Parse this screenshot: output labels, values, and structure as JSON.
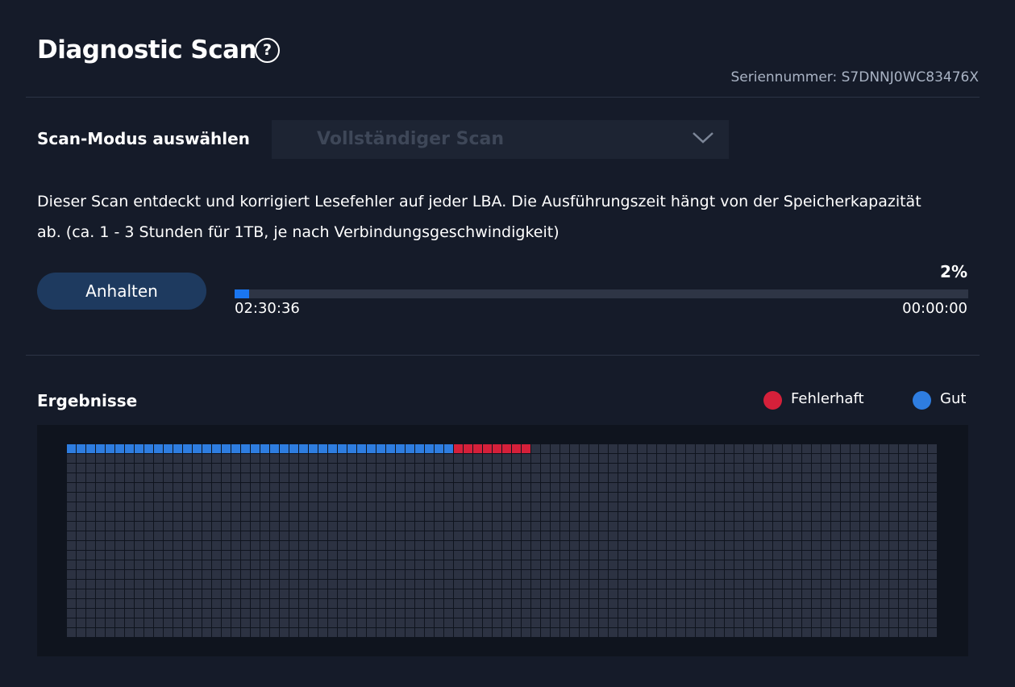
{
  "header": {
    "title": "Diagnostic Scan",
    "help_icon": "question-circle-icon",
    "help_glyph": "?",
    "serial": "Seriennummer: S7DNNJ0WC83476X"
  },
  "scan_mode": {
    "label": "Scan-Modus auswählen",
    "selected": "Vollständiger Scan",
    "dropdown_icon": "chevron-down-icon"
  },
  "description": "Dieser Scan entdeckt und korrigiert Lesefehler auf jeder LBA. Die Ausführungszeit hängt von der Speicherkapazität ab. (ca. 1 - 3 Stunden für 1TB, je nach Verbindungsgeschwindigkeit)",
  "progress": {
    "button_label": "Anhalten",
    "percent_label": "2%",
    "value": 0.02,
    "elapsed": "02:30:36",
    "remaining": "00:00:00"
  },
  "results": {
    "label": "Ergebnisse",
    "legend": [
      {
        "label": "Fehlerhaft",
        "color": "#d5203a"
      },
      {
        "label": "Gut",
        "color": "#2e7de0"
      }
    ],
    "grid": {
      "columns": 90,
      "rows": 20,
      "good_blocks": 40,
      "bad_blocks": 8
    },
    "colors": {
      "good": "#2e7de0",
      "bad": "#d5203a",
      "pending": "#2c3242"
    }
  },
  "colors": {
    "background": "#151b29",
    "accent": "#1a76f0",
    "button": "#1e3a5f"
  }
}
